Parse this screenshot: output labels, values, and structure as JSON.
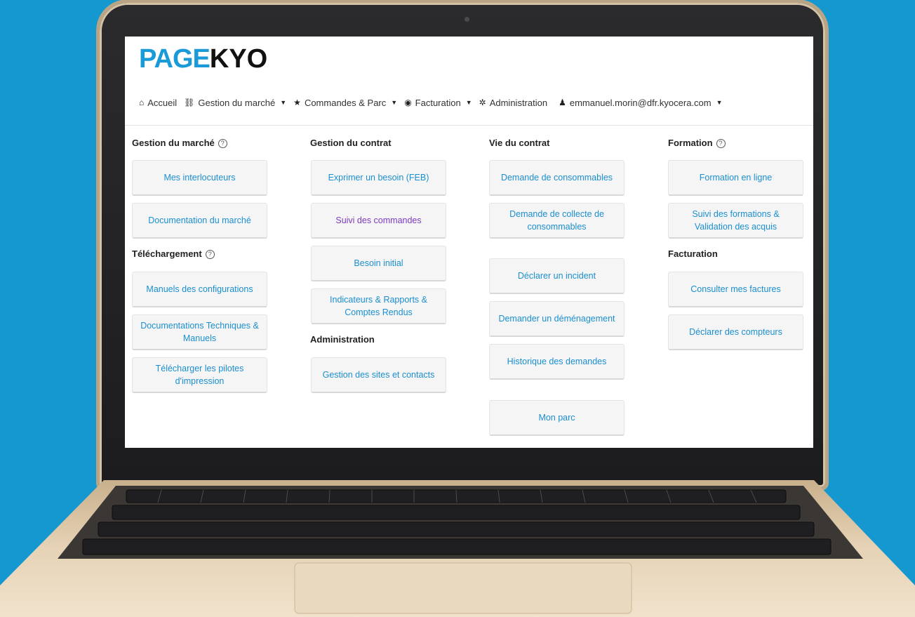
{
  "brand": {
    "logo_part1": "PAGE",
    "logo_part2": "KYO"
  },
  "nav": [
    {
      "label": "Accueil",
      "icon": "home-icon",
      "glyph": "⌂",
      "dropdown": false
    },
    {
      "label": "Gestion du marché",
      "icon": "link-icon",
      "glyph": "⛓",
      "dropdown": true
    },
    {
      "label": "Commandes & Parc",
      "icon": "star-icon",
      "glyph": "★",
      "dropdown": true
    },
    {
      "label": "Facturation",
      "icon": "eye-icon",
      "glyph": "◉",
      "dropdown": true
    },
    {
      "label": "Administration",
      "icon": "gear-icon",
      "glyph": "✲",
      "dropdown": false
    },
    {
      "label": "emmanuel.morin@dfr.kyocera.com",
      "icon": "user-icon",
      "glyph": "♟",
      "dropdown": true
    }
  ],
  "sections": {
    "gestion_marche": {
      "title": "Gestion du marché",
      "help": "?"
    },
    "telechargement": {
      "title": "Téléchargement",
      "help": "?"
    },
    "gestion_contrat": {
      "title": "Gestion du contrat"
    },
    "administration": {
      "title": "Administration"
    },
    "vie_contrat": {
      "title": "Vie du contrat"
    },
    "formation": {
      "title": "Formation",
      "help": "?"
    },
    "facturation": {
      "title": "Facturation"
    }
  },
  "tiles": {
    "mes_interlocuteurs": "Mes interlocuteurs",
    "documentation_marche": "Documentation du marché",
    "manuels_configurations": "Manuels des configurations",
    "documentations_techniques": "Documentations Techniques & Manuels",
    "telecharger_pilotes": "Télécharger les pilotes d'impression",
    "exprimer_besoin": "Exprimer un besoin (FEB)",
    "suivi_commandes": "Suivi des commandes",
    "besoin_initial": "Besoin initial",
    "indicateurs_rapports": "Indicateurs & Rapports & Comptes Rendus",
    "gestion_sites": "Gestion des sites et contacts",
    "demande_consommables": "Demande de consommables",
    "demande_collecte": "Demande de collecte de consommables",
    "declarer_incident": "Déclarer un incident",
    "demander_demenagement": "Demander un déménagement",
    "historique_demandes": "Historique des demandes",
    "mon_parc": "Mon parc",
    "formation_en_ligne": "Formation en ligne",
    "suivi_formations": "Suivi des formations & Validation des acquis",
    "consulter_factures": "Consulter mes factures",
    "declarer_compteurs": "Déclarer des compteurs"
  },
  "colors": {
    "link": "#1a8fd0",
    "visited": "#7d3bc2",
    "brand_blue": "#1a9ad6",
    "background": "#1598cf"
  }
}
